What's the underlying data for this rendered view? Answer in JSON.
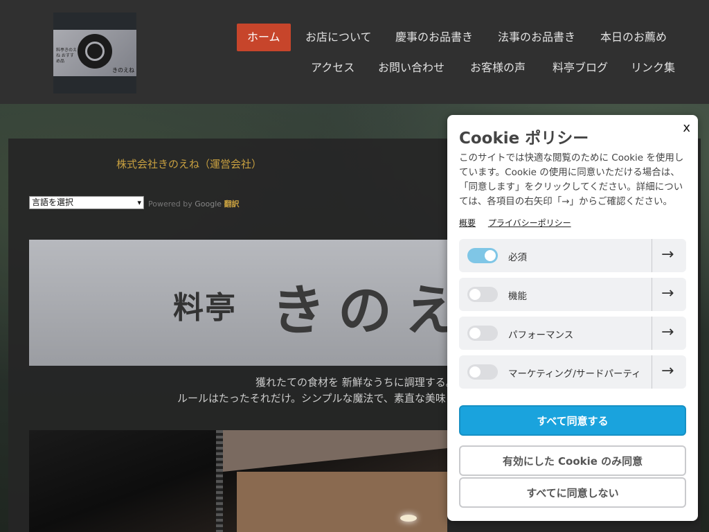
{
  "logo": {
    "left_text": "料亭きのえね おすすめ品",
    "right_text": "きのえね"
  },
  "nav": {
    "row1": [
      "ホーム",
      "お店について",
      "慶事のお品書き",
      "法事のお品書き",
      "本日のお薦め"
    ],
    "row2": [
      "アクセス",
      "お問い合わせ",
      "お客様の声",
      "料亭ブログ",
      "リンク集"
    ]
  },
  "company": "株式会社きのえね（運営会社）",
  "translate": {
    "select_value": "言語を選択",
    "powered": "Powered by",
    "google": "Google",
    "translate": "翻訳"
  },
  "banner": {
    "small": "料亭",
    "big": "きのえ"
  },
  "tagline": {
    "line1": "獲れたての食材を 新鮮なうちに調理する。",
    "line2": "ルールはたったそれだけ。シンプルな魔法で、素直な美味し"
  },
  "cookie": {
    "close": "x",
    "title": "Cookie ポリシー",
    "description": "このサイトでは快適な閲覧のために Cookie を使用しています。Cookie の使用に同意いただける場合は、「同意します」をクリックしてください。詳細については、各項目の右矢印「→」からご確認ください。",
    "link_overview": "概要",
    "link_privacy": "プライバシーポリシー",
    "categories": [
      {
        "label": "必須",
        "enabled": true
      },
      {
        "label": "機能",
        "enabled": false
      },
      {
        "label": "パフォーマンス",
        "enabled": false
      },
      {
        "label": "マーケティング/サードパーティ",
        "enabled": false
      }
    ],
    "arrow": "→",
    "accept_all": "すべて同意する",
    "accept_selected": "有効にした Cookie のみ同意",
    "reject_all": "すべてに同意しない"
  },
  "colors": {
    "accent_nav": "#c7452b",
    "primary_button": "#1aa3dd",
    "company_text": "#c8a040"
  }
}
